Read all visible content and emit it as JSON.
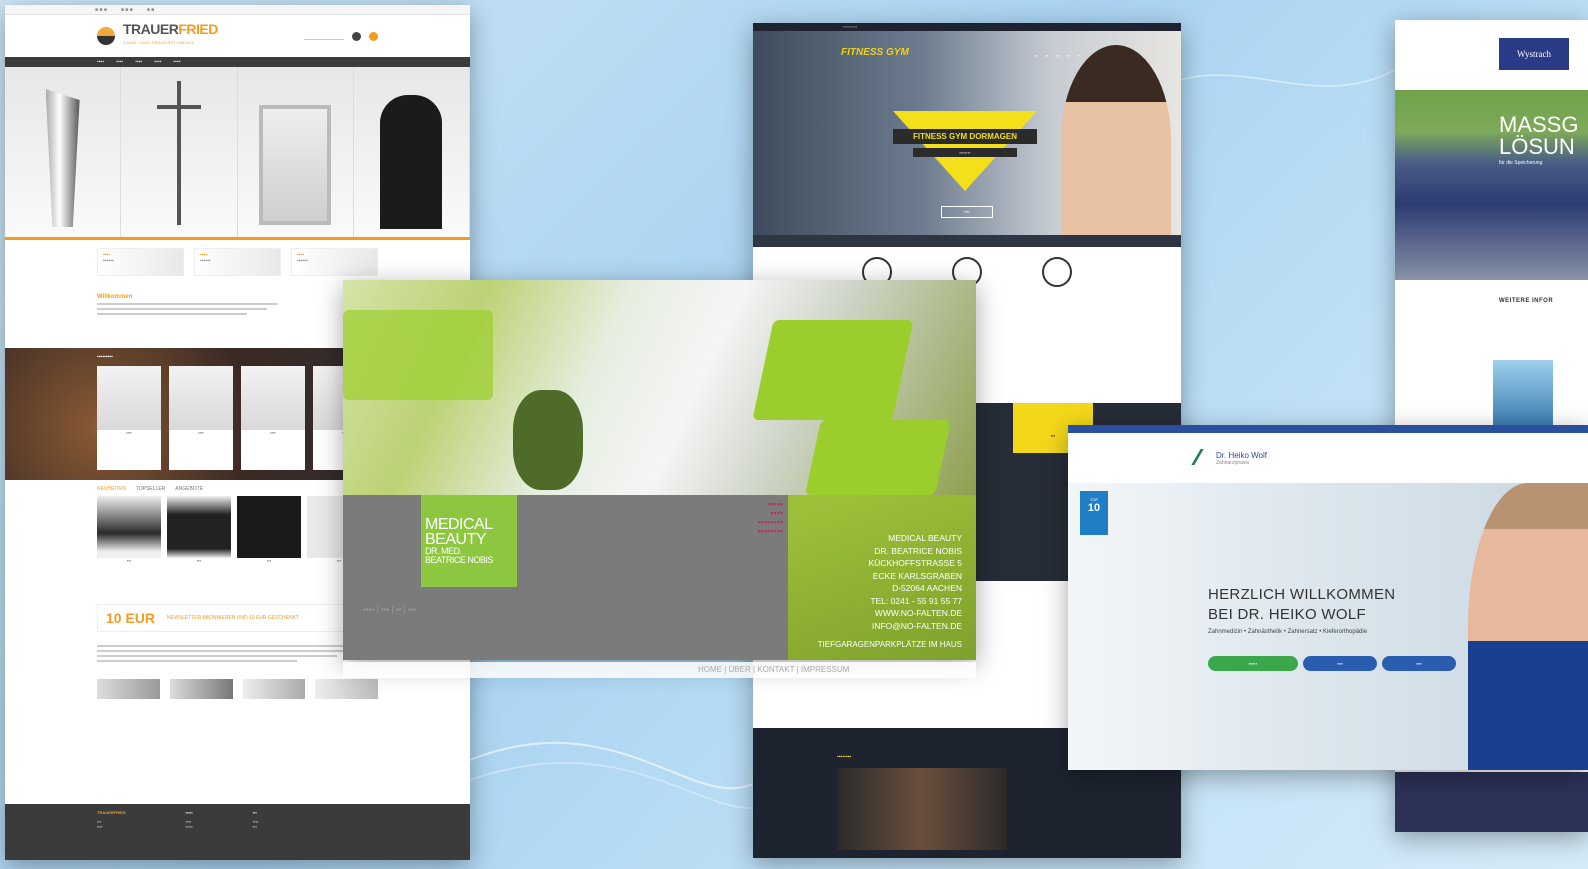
{
  "trauerfried": {
    "brand_a": "TRAUER",
    "brand_b": "FRIED",
    "tagline": "GRAB- UND TRAUERSCHMUCK",
    "welcome_heading": "Willkommen",
    "tabs": [
      "NEUHEITEN",
      "TOPSELLER",
      "ANGEBOTE"
    ],
    "promo_value": "10 EUR",
    "promo_text": "NEWSLETTER ABONNIEREN UND 10 EUR GESCHENKT",
    "footer_brand": "TRAUERFRIED"
  },
  "gym": {
    "logo": "FITNESS GYM",
    "title": "FITNESS GYM DORMAGEN"
  },
  "wystrach": {
    "logo": "Wystrach",
    "hero_line1": "MASSG",
    "hero_line2": "LÖSUN",
    "hero_small": "für die Speicherung",
    "more": "WEITERE INFOR"
  },
  "medical": {
    "logo_line1": "MEDICAL",
    "logo_line2": "BEAUTY",
    "logo_line3": "DR. MED.",
    "logo_line4": "BEATRICE NOBIS",
    "address": [
      "MEDICAL BEAUTY",
      "DR. BEATRICE NOBIS",
      "KÜCKHOFFSTRASSE 5",
      "ECKE KARLSGRABEN",
      "D-52064 AACHEN",
      "TEL: 0241 - 55 91 55 77",
      "WWW.NO-FALTEN.DE",
      "INFO@NO-FALTEN.DE"
    ],
    "parking": "TIEFGARAGENPARKPLÄTZE IM HAUS",
    "nav_home": "HOME",
    "nav_ueber": "ÜBER",
    "nav_kontakt": "KONTAKT",
    "nav_impressum": "IMPRESSUM"
  },
  "wolf": {
    "logo": "Dr. Heiko Wolf",
    "logo_sub": "Zahnarztpraxis",
    "badge_top": "TOP",
    "badge_num": "10",
    "headline_1": "HERZLICH WILLKOMMEN",
    "headline_2": "BEI DR. HEIKO WOLF",
    "subline": "Zahnmedizin • Zahnästhetik • Zahnersatz • Kieferorthopädie"
  }
}
